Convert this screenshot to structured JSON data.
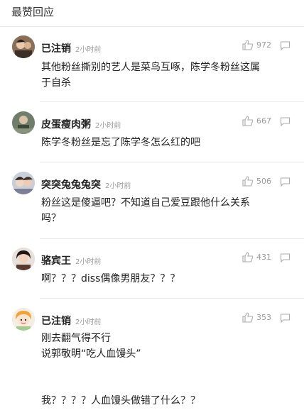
{
  "section_title": "最赞回应",
  "comments": [
    {
      "user": "已注销",
      "time": "2小时前",
      "likes": "972",
      "text": "其他粉丝撕别的艺人是菜鸟互啄，陈学冬粉丝这属\n于自杀"
    },
    {
      "user": "皮蛋瘦肉粥",
      "time": "2小时前",
      "likes": "667",
      "text": "陈学冬粉丝是忘了陈学冬怎么红的吧"
    },
    {
      "user": "突突兔兔兔突",
      "time": "2小时前",
      "likes": "506",
      "text": "粉丝这是傻逼吧？不知道自己爱豆跟他什么关系\n吗？"
    },
    {
      "user": "骆宾王",
      "time": "2小时前",
      "likes": "431",
      "text": "啊？？？diss偶像男朋友？？？"
    },
    {
      "user": "已注销",
      "time": "2小时前",
      "likes": "353",
      "text": "刚去翻气得不行\n说郭敬明“吃人血馒头”\n\n\n我？？？？人血馒头做错了什么？？"
    }
  ],
  "icons": {
    "like": "thumbs-up-icon",
    "reply": "comment-bubble-icon"
  },
  "colors": {
    "text": "#222222",
    "meta": "#9a9a9a",
    "divider": "#e8e8e8"
  }
}
